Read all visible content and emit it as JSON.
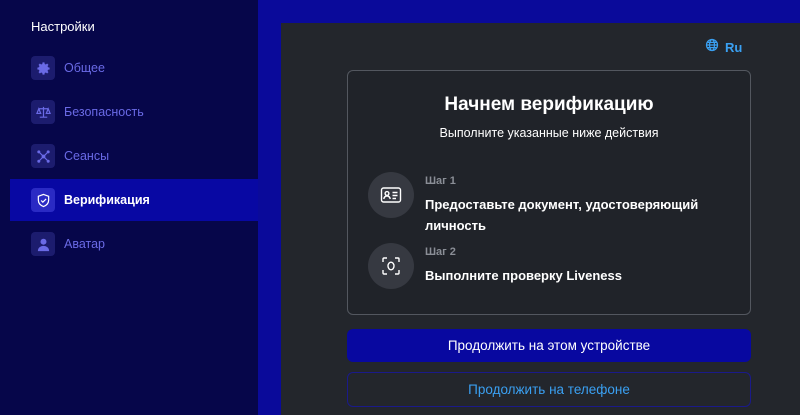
{
  "sidebar": {
    "title": "Настройки",
    "items": [
      {
        "label": "Общее",
        "icon": "gear-icon",
        "active": false
      },
      {
        "label": "Безопасность",
        "icon": "scales-icon",
        "active": false
      },
      {
        "label": "Сеансы",
        "icon": "sessions-icon",
        "active": false
      },
      {
        "label": "Верификация",
        "icon": "shield-icon",
        "active": true
      },
      {
        "label": "Аватар",
        "icon": "user-icon",
        "active": false
      }
    ]
  },
  "main": {
    "language": {
      "label": "Ru",
      "icon": "globe-icon"
    },
    "card": {
      "title": "Начнем верификацию",
      "subtitle": "Выполните указанные ниже действия",
      "steps": [
        {
          "label": "Шаг 1",
          "text": "Предоставьте документ, удостоверяющий личность",
          "icon": "id-card-icon"
        },
        {
          "label": "Шаг 2",
          "text": "Выполните проверку Liveness",
          "icon": "face-scan-icon"
        }
      ]
    },
    "buttons": {
      "primary": "Продолжить на этом устройстве",
      "secondary": "Продолжить на телефоне"
    }
  },
  "colors": {
    "accent": "#0808a0",
    "link": "#3aa0f2",
    "sidebar_bg": "#06064a",
    "main_bg": "#23262c"
  }
}
